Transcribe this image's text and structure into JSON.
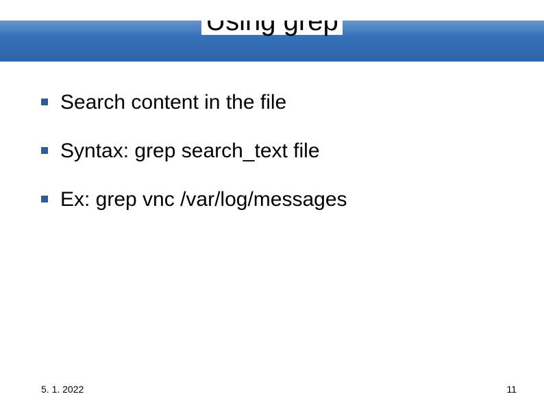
{
  "title": "Using grep",
  "bullets": [
    "Search content in the file",
    "Syntax: grep search_text file",
    "Ex: grep vnc /var/log/messages"
  ],
  "footer": {
    "date": "5. 1. 2022",
    "page": "11"
  }
}
